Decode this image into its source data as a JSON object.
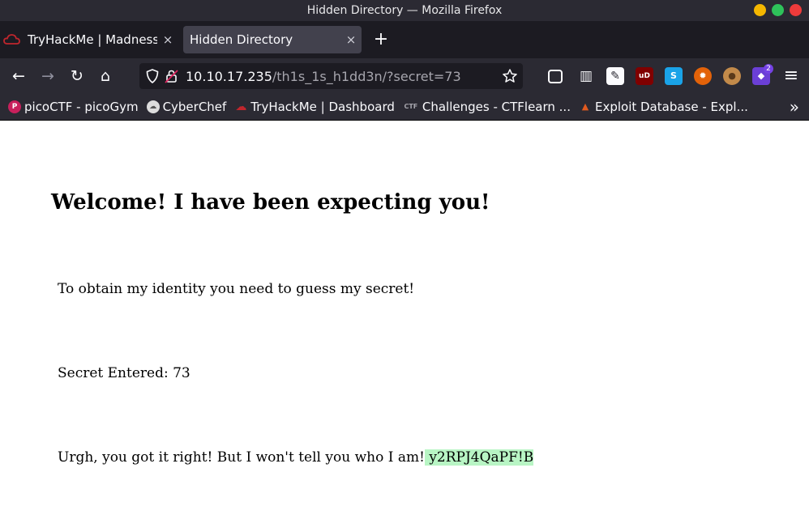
{
  "window": {
    "title": "Hidden Directory — Mozilla Firefox",
    "controls": {
      "minimize_color": "#f5b700",
      "maximize_color": "#2ec25a",
      "close_color": "#ee3b3b"
    }
  },
  "tabs": [
    {
      "label": "TryHackMe | Madness",
      "active": false
    },
    {
      "label": "Hidden Directory",
      "active": true
    }
  ],
  "tab_close_glyph": "×",
  "new_tab_glyph": "+",
  "nav": {
    "back_glyph": "←",
    "forward_glyph": "→",
    "reload_glyph": "↻",
    "home_glyph": "⌂"
  },
  "url": {
    "host": "10.10.17.235",
    "path": "/th1s_1s_h1dd3n/?secret=73"
  },
  "toolbar_icons": [
    {
      "name": "pocket-icon",
      "glyph": "◈",
      "color": "#2b2a33"
    },
    {
      "name": "reader-icon",
      "glyph": "▥",
      "color": "#2b2a33"
    },
    {
      "name": "extension-icon",
      "glyph": "✎",
      "color": "#2b2a33"
    },
    {
      "name": "ublock-icon",
      "glyph": "uD",
      "color": "#800000"
    },
    {
      "name": "stylus-icon",
      "glyph": "S",
      "color": "#1aa3e8"
    },
    {
      "name": "foxy-icon",
      "glyph": "✹",
      "color": "#e36209"
    },
    {
      "name": "cookie-icon",
      "glyph": "●",
      "color": "#c28a4a"
    },
    {
      "name": "wappalyzer-icon",
      "glyph": "◆",
      "color": "#6b3fd6"
    }
  ],
  "badge_count": "2",
  "menu_glyph": "≡",
  "bookmarks": [
    {
      "label": "picoCTF - picoGym",
      "fav_glyph": "P",
      "fav_color": "#c8205c"
    },
    {
      "label": "CyberChef",
      "fav_glyph": "☁",
      "fav_color": "#888888"
    },
    {
      "label": "TryHackMe | Dashboard",
      "fav_glyph": "☁",
      "fav_color": "#c0262d"
    },
    {
      "label": "Challenges - CTFlearn ...",
      "fav_glyph": "CTF",
      "fav_color": "#555555"
    },
    {
      "label": "Exploit Database - Expl...",
      "fav_glyph": "▲",
      "fav_color": "#e05a1f"
    }
  ],
  "bookmarks_overflow_glyph": "»",
  "page": {
    "heading": "Welcome! I have been expecting you!",
    "intro": "To obtain my identity you need to guess my secret!",
    "secret_entered": "Secret Entered: 73",
    "result": "Urgh, you got it right! But I won't tell you who I am!",
    "secret_value": " y2RPJ4QaPF!B "
  }
}
